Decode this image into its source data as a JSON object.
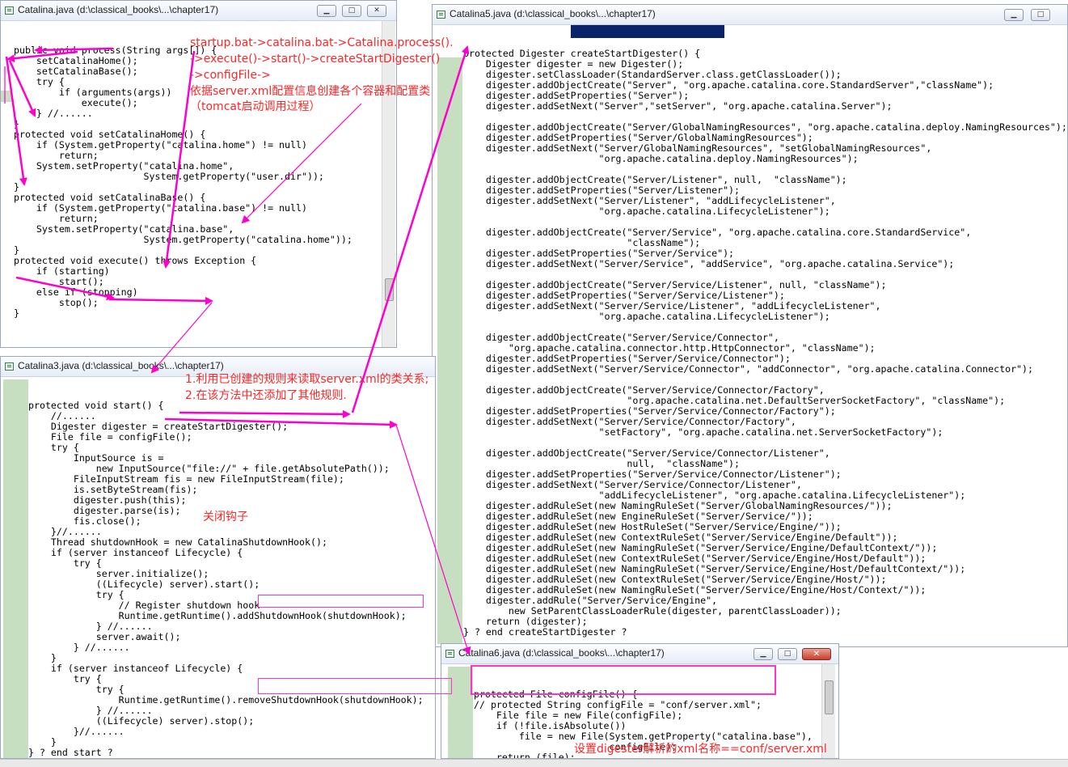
{
  "colors": {
    "annotation": "#ff2626",
    "arrow": "#ff00cc",
    "coverage": "#c6dfc0",
    "selection": "#0a246a"
  },
  "icons": [
    "java-file-icon",
    "minimize-icon",
    "maximize-icon",
    "close-icon"
  ],
  "windows": {
    "w1": {
      "title": "Catalina.java (d:\\classical_books\\...\\chapter17)"
    },
    "w2": {
      "title": "Catalina5.java (d:\\classical_books\\...\\chapter17)"
    },
    "w3": {
      "title": "Catalina3.java (d:\\classical_books\\...\\chapter17)"
    },
    "w4": {
      "title": "Catalina6.java (d:\\classical_books\\...\\chapter17)"
    }
  },
  "buttons": {
    "minimize": "▁",
    "maximize": "□",
    "close": "✕"
  },
  "code": {
    "w1": [
      "public void process(String args[]) {",
      "    setCatalinaHome();",
      "    setCatalinaBase();",
      "    try {",
      "        if (arguments(args))",
      "            execute();",
      "    } //......",
      "}",
      "protected void setCatalinaHome() {",
      "    if (System.getProperty(\"catalina.home\") != null)",
      "        return;",
      "    System.setProperty(\"catalina.home\",",
      "                       System.getProperty(\"user.dir\"));",
      "}",
      "protected void setCatalinaBase() {",
      "    if (System.getProperty(\"catalina.base\") != null)",
      "        return;",
      "    System.setProperty(\"catalina.base\",",
      "                       System.getProperty(\"catalina.home\"));",
      "}",
      "protected void execute() throws Exception {",
      "    if (starting)",
      "        start();",
      "    else if (stopping)",
      "        stop();",
      "}"
    ],
    "w2": [
      "protected Digester createStartDigester() {",
      "    Digester digester = new Digester();",
      "    digester.setClassLoader(StandardServer.class.getClassLoader());",
      "    digester.addObjectCreate(\"Server\", \"org.apache.catalina.core.StandardServer\",\"className\");",
      "    digester.addSetProperties(\"Server\");",
      "    digester.addSetNext(\"Server\",\"setServer\", \"org.apache.catalina.Server\");",
      "",
      "    digester.addObjectCreate(\"Server/GlobalNamingResources\", \"org.apache.catalina.deploy.NamingResources\");",
      "    digester.addSetProperties(\"Server/GlobalNamingResources\");",
      "    digester.addSetNext(\"Server/GlobalNamingResources\", \"setGlobalNamingResources\",",
      "                        \"org.apache.catalina.deploy.NamingResources\");",
      "",
      "    digester.addObjectCreate(\"Server/Listener\", null,  \"className\");",
      "    digester.addSetProperties(\"Server/Listener\");",
      "    digester.addSetNext(\"Server/Listener\", \"addLifecycleListener\",",
      "                        \"org.apache.catalina.LifecycleListener\");",
      "",
      "    digester.addObjectCreate(\"Server/Service\", \"org.apache.catalina.core.StandardService\",",
      "                             \"className\");",
      "    digester.addSetProperties(\"Server/Service\");",
      "    digester.addSetNext(\"Server/Service\", \"addService\", \"org.apache.catalina.Service\");",
      "",
      "    digester.addObjectCreate(\"Server/Service/Listener\", null, \"className\");",
      "    digester.addSetProperties(\"Server/Service/Listener\");",
      "    digester.addSetNext(\"Server/Service/Listener\", \"addLifecycleListener\",",
      "                        \"org.apache.catalina.LifecycleListener\");",
      "",
      "    digester.addObjectCreate(\"Server/Service/Connector\",",
      "        \"org.apache.catalina.connector.http.HttpConnector\", \"className\");",
      "    digester.addSetProperties(\"Server/Service/Connector\");",
      "    digester.addSetNext(\"Server/Service/Connector\", \"addConnector\", \"org.apache.catalina.Connector\");",
      "",
      "    digester.addObjectCreate(\"Server/Service/Connector/Factory\",",
      "                             \"org.apache.catalina.net.DefaultServerSocketFactory\", \"className\");",
      "    digester.addSetProperties(\"Server/Service/Connector/Factory\");",
      "    digester.addSetNext(\"Server/Service/Connector/Factory\",",
      "                        \"setFactory\", \"org.apache.catalina.net.ServerSocketFactory\");",
      "",
      "    digester.addObjectCreate(\"Server/Service/Connector/Listener\",",
      "                             null,  \"className\");",
      "    digester.addSetProperties(\"Server/Service/Connector/Listener\");",
      "    digester.addSetNext(\"Server/Service/Connector/Listener\",",
      "                        \"addLifecycleListener\", \"org.apache.catalina.LifecycleListener\");",
      "    digester.addRuleSet(new NamingRuleSet(\"Server/GlobalNamingResources/\"));",
      "    digester.addRuleSet(new EngineRuleSet(\"Server/Service/\"));",
      "    digester.addRuleSet(new HostRuleSet(\"Server/Service/Engine/\"));",
      "    digester.addRuleSet(new ContextRuleSet(\"Server/Service/Engine/Default\"));",
      "    digester.addRuleSet(new NamingRuleSet(\"Server/Service/Engine/DefaultContext/\"));",
      "    digester.addRuleSet(new ContextRuleSet(\"Server/Service/Engine/Host/Default\"));",
      "    digester.addRuleSet(new NamingRuleSet(\"Server/Service/Engine/Host/DefaultContext/\"));",
      "    digester.addRuleSet(new ContextRuleSet(\"Server/Service/Engine/Host/\"));",
      "    digester.addRuleSet(new NamingRuleSet(\"Server/Service/Engine/Host/Context/\"));",
      "    digester.addRule(\"Server/Service/Engine\",",
      "        new SetParentClassLoaderRule(digester, parentClassLoader));",
      "    return (digester);",
      "} ? end createStartDigester ?"
    ],
    "w3": [
      "protected void start() {",
      "    //......",
      "    Digester digester = createStartDigester();",
      "    File file = configFile();",
      "    try {",
      "        InputSource is =",
      "            new InputSource(\"file://\" + file.getAbsolutePath());",
      "        FileInputStream fis = new FileInputStream(file);",
      "        is.setByteStream(fis);",
      "        digester.push(this);",
      "        digester.parse(is);",
      "        fis.close();",
      "    }//......",
      "    Thread shutdownHook = new CatalinaShutdownHook();",
      "    if (server instanceof Lifecycle) {",
      "        try {",
      "            server.initialize();",
      "            ((Lifecycle) server).start();",
      "            try {",
      "                // Register shutdown hook",
      "                Runtime.getRuntime().addShutdownHook(shutdownHook);",
      "            } //......",
      "            server.await();",
      "        } //......",
      "    }",
      "    if (server instanceof Lifecycle) {",
      "        try {",
      "            try {",
      "                Runtime.getRuntime().removeShutdownHook(shutdownHook);",
      "            } //......",
      "            ((Lifecycle) server).stop();",
      "        }//......",
      "    }",
      "} ? end start ?"
    ],
    "w4": [
      "protected File configFile() {",
      "// protected String configFile = \"conf/server.xml\";",
      "    File file = new File(configFile);",
      "    if (!file.isAbsolute())",
      "        file = new File(System.getProperty(\"catalina.base\"),",
      "                        configFile);",
      "    return (file);",
      "}"
    ]
  },
  "annotations": {
    "a1": "startup.bat->catalina.bat->Catalina.process().",
    "a2": "->execute()->start()->createStartDigester()",
    "a3": "->configFile->",
    "a4": "依据server.xml配置信息创建各个容器和配置类",
    "a5": "（tomcat启动调用过程）",
    "a6": "1.利用已创建的规则来读取server.xml的类关系;",
    "a7": "2.在该方法中还添加了其他规则.",
    "a8": "关闭钩子",
    "a9": "设置digester解析的xml名称==conf/server.xml"
  }
}
